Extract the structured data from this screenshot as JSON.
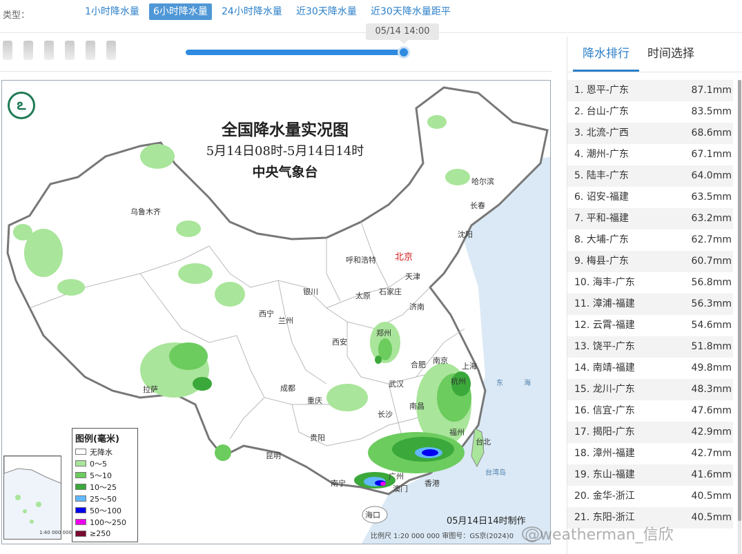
{
  "type_bar": {
    "label": "类型：",
    "tabs": [
      {
        "label": "1小时降水量",
        "active": false
      },
      {
        "label": "6小时降水量",
        "active": true
      },
      {
        "label": "24小时降水量",
        "active": false
      },
      {
        "label": "近30天降水量",
        "active": false
      },
      {
        "label": "近30天降水量距平",
        "active": false
      }
    ]
  },
  "time_slider": {
    "tooltip": "05/14 14:00",
    "progress": 1.0
  },
  "map": {
    "title": "全国降水量实况图",
    "subtitle": "5月14日08时-5月14日14时",
    "org": "中央气象台",
    "made_time": "05月14日14时制作",
    "scale_text": "比例尺 1:20 000 000    审图号：GS京(2024)0",
    "inset_scale": "1:40 000 000",
    "cities": [
      "乌鲁木齐",
      "哈尔滨",
      "长春",
      "沈阳",
      "北京",
      "天津",
      "呼和浩特",
      "石家庄",
      "太原",
      "济南",
      "银川",
      "西宁",
      "兰州",
      "郑州",
      "西安",
      "合肥",
      "南京",
      "上海",
      "杭州",
      "武汉",
      "成都",
      "重庆",
      "南昌",
      "长沙",
      "拉萨",
      "贵阳",
      "福州",
      "台北",
      "昆明",
      "南宁",
      "广州",
      "澳门",
      "香港",
      "海口"
    ],
    "seas": [
      "东",
      "海",
      "台湾岛"
    ],
    "legend": {
      "title": "图例(毫米)",
      "items": [
        {
          "label": "无降水",
          "color": "#ffffff"
        },
        {
          "label": "0～5",
          "color": "#a9e59a"
        },
        {
          "label": "5～10",
          "color": "#6ccc5e"
        },
        {
          "label": "10～25",
          "color": "#3aa83a"
        },
        {
          "label": "25～50",
          "color": "#61b8ff"
        },
        {
          "label": "50～100",
          "color": "#0000ee"
        },
        {
          "label": "100～250",
          "color": "#ee00ee"
        },
        {
          "label": "≥250",
          "color": "#7a0a30"
        }
      ]
    }
  },
  "panel": {
    "tabs": [
      {
        "label": "降水排行",
        "active": true
      },
      {
        "label": "时间选择",
        "active": false
      }
    ],
    "ranking": [
      {
        "name": "1. 恩平-广东",
        "value": "87.1mm"
      },
      {
        "name": "2. 台山-广东",
        "value": "83.5mm"
      },
      {
        "name": "3. 北流-广西",
        "value": "68.6mm"
      },
      {
        "name": "4. 潮州-广东",
        "value": "67.1mm"
      },
      {
        "name": "5. 陆丰-广东",
        "value": "64.0mm"
      },
      {
        "name": "6. 诏安-福建",
        "value": "63.5mm"
      },
      {
        "name": "7. 平和-福建",
        "value": "63.2mm"
      },
      {
        "name": "8. 大埔-广东",
        "value": "62.7mm"
      },
      {
        "name": "9. 梅县-广东",
        "value": "60.7mm"
      },
      {
        "name": "10. 海丰-广东",
        "value": "56.8mm"
      },
      {
        "name": "11. 漳浦-福建",
        "value": "56.3mm"
      },
      {
        "name": "12. 云霄-福建",
        "value": "54.6mm"
      },
      {
        "name": "13. 饶平-广东",
        "value": "51.8mm"
      },
      {
        "name": "14. 南靖-福建",
        "value": "49.8mm"
      },
      {
        "name": "15. 龙川-广东",
        "value": "48.3mm"
      },
      {
        "name": "16. 信宜-广东",
        "value": "47.6mm"
      },
      {
        "name": "17. 揭阳-广东",
        "value": "42.9mm"
      },
      {
        "name": "18. 漳州-福建",
        "value": "42.7mm"
      },
      {
        "name": "19. 东山-福建",
        "value": "41.6mm"
      },
      {
        "name": "20. 金华-浙江",
        "value": "40.5mm"
      },
      {
        "name": "21. 东阳-浙江",
        "value": "40.5mm"
      }
    ]
  },
  "watermark": "@weatherman_信欣"
}
